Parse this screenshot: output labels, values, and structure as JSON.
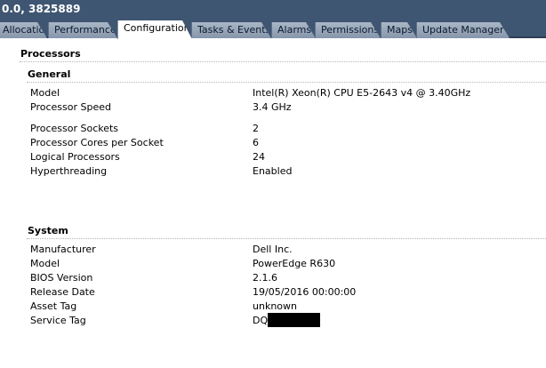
{
  "window": {
    "title": "0.0, 3825889"
  },
  "tabs": [
    {
      "label": "Allocation",
      "active": false
    },
    {
      "label": "Performance",
      "active": false
    },
    {
      "label": "Configuration",
      "active": true
    },
    {
      "label": "Tasks & Events",
      "active": false
    },
    {
      "label": "Alarms",
      "active": false
    },
    {
      "label": "Permissions",
      "active": false
    },
    {
      "label": "Maps",
      "active": false
    },
    {
      "label": "Update Manager",
      "active": false
    }
  ],
  "processors": {
    "title": "Processors",
    "general": {
      "title": "General",
      "rows": [
        {
          "label": "Model",
          "value": "Intel(R) Xeon(R) CPU E5-2643 v4 @ 3.40GHz"
        },
        {
          "label": "Processor Speed",
          "value": "3.4 GHz"
        },
        {
          "label": "Processor Sockets",
          "value": "2"
        },
        {
          "label": "Processor Cores per Socket",
          "value": "6"
        },
        {
          "label": "Logical Processors",
          "value": "24"
        },
        {
          "label": "Hyperthreading",
          "value": "Enabled"
        }
      ]
    },
    "system": {
      "title": "System",
      "rows": [
        {
          "label": "Manufacturer",
          "value": "Dell Inc."
        },
        {
          "label": "Model",
          "value": "PowerEdge R630"
        },
        {
          "label": "BIOS Version",
          "value": "2.1.6"
        },
        {
          "label": "Release Date",
          "value": "19/05/2016 00:00:00"
        },
        {
          "label": "Asset Tag",
          "value": "unknown"
        },
        {
          "label": "Service Tag",
          "value": "DQ"
        }
      ]
    }
  },
  "colors": {
    "header_bg": "#3f5672",
    "tab_inactive": "#96a4b7",
    "tab_active": "#ffffff"
  }
}
